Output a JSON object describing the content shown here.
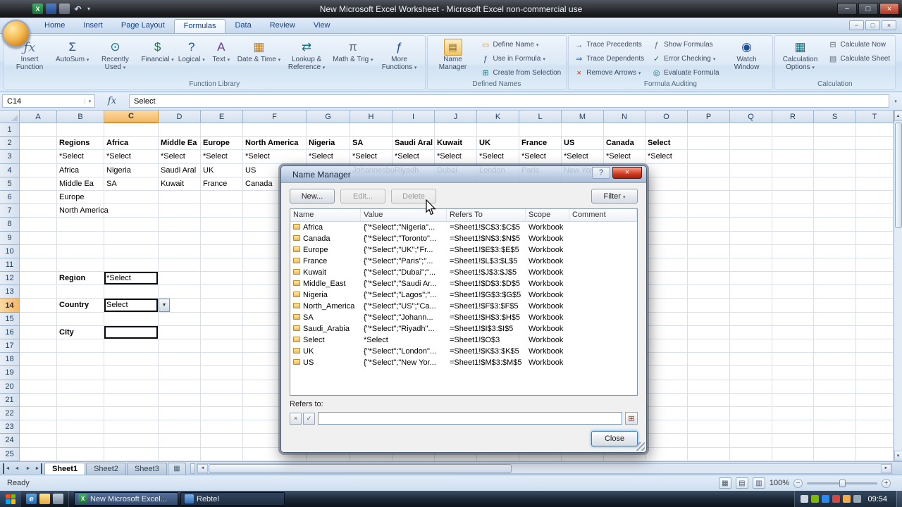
{
  "titlebar": {
    "title": "New Microsoft Excel Worksheet  -  Microsoft Excel non-commercial use"
  },
  "ribbon": {
    "tabs": [
      "Home",
      "Insert",
      "Page Layout",
      "Formulas",
      "Data",
      "Review",
      "View"
    ],
    "active_tab": "Formulas",
    "function_library_label": "Function Library",
    "insert_function": "Insert Function",
    "autosum": "AutoSum",
    "recently_used": "Recently Used",
    "financial": "Financial",
    "logical": "Logical",
    "text": "Text",
    "date_time": "Date & Time",
    "lookup_reference": "Lookup & Reference",
    "math_trig": "Math & Trig",
    "more_functions": "More Functions",
    "defined_names_label": "Defined Names",
    "name_manager": "Name Manager",
    "define_name": "Define Name",
    "use_in_formula": "Use in Formula",
    "create_from_selection": "Create from Selection",
    "formula_auditing_label": "Formula Auditing",
    "trace_precedents": "Trace Precedents",
    "trace_dependents": "Trace Dependents",
    "remove_arrows": "Remove Arrows",
    "show_formulas": "Show Formulas",
    "error_checking": "Error Checking",
    "evaluate_formula": "Evaluate Formula",
    "watch_window": "Watch Window",
    "calculation_label": "Calculation",
    "calculation_options": "Calculation Options",
    "calculate_now": "Calculate Now",
    "calculate_sheet": "Calculate Sheet"
  },
  "formula_bar": {
    "name_box": "C14",
    "formula": "Select"
  },
  "grid": {
    "columns": [
      [
        "A",
        53
      ],
      [
        "B",
        67
      ],
      [
        "C",
        77
      ],
      [
        "D",
        60
      ],
      [
        "E",
        60
      ],
      [
        "F",
        90
      ],
      [
        "G",
        62
      ],
      [
        "H",
        60
      ],
      [
        "I",
        60
      ],
      [
        "J",
        60
      ],
      [
        "K",
        60
      ],
      [
        "L",
        60
      ],
      [
        "M",
        60
      ],
      [
        "N",
        59
      ],
      [
        "O",
        60
      ],
      [
        "P",
        60
      ],
      [
        "Q",
        60
      ],
      [
        "R",
        59
      ],
      [
        "S",
        60
      ],
      [
        "T",
        53
      ]
    ],
    "rows": 25,
    "active_cell": "C14",
    "selected_col": "C",
    "selected_row": 14,
    "cells": {
      "B2": {
        "t": "Regions",
        "b": 1
      },
      "C2": {
        "t": "Africa",
        "b": 1
      },
      "D2": {
        "t": "Middle Ea",
        "b": 1
      },
      "E2": {
        "t": "Europe",
        "b": 1
      },
      "F2": {
        "t": "North America",
        "b": 1
      },
      "G2": {
        "t": "Nigeria",
        "b": 1
      },
      "H2": {
        "t": "SA",
        "b": 1
      },
      "I2": {
        "t": "Saudi Aral",
        "b": 1
      },
      "J2": {
        "t": "Kuwait",
        "b": 1
      },
      "K2": {
        "t": "UK",
        "b": 1
      },
      "L2": {
        "t": "France",
        "b": 1
      },
      "M2": {
        "t": "US",
        "b": 1
      },
      "N2": {
        "t": "Canada",
        "b": 1
      },
      "O2": {
        "t": "Select",
        "b": 1
      },
      "B3": {
        "t": "*Select"
      },
      "C3": {
        "t": "*Select"
      },
      "D3": {
        "t": "*Select"
      },
      "E3": {
        "t": "*Select"
      },
      "F3": {
        "t": "*Select"
      },
      "G3": {
        "t": "*Select"
      },
      "H3": {
        "t": "*Select"
      },
      "I3": {
        "t": "*Select"
      },
      "J3": {
        "t": "*Select"
      },
      "K3": {
        "t": "*Select"
      },
      "L3": {
        "t": "*Select"
      },
      "M3": {
        "t": "*Select"
      },
      "N3": {
        "t": "*Select"
      },
      "O3": {
        "t": "*Select"
      },
      "B4": {
        "t": "Africa"
      },
      "C4": {
        "t": "Nigeria"
      },
      "D4": {
        "t": "Saudi Aral"
      },
      "E4": {
        "t": "UK"
      },
      "F4": {
        "t": "US"
      },
      "H4": {
        "t": "Johannesbu"
      },
      "I4": {
        "t": "Riyadh"
      },
      "J4": {
        "t": "Dubai"
      },
      "K4": {
        "t": "London"
      },
      "L4": {
        "t": "Paris"
      },
      "M4": {
        "t": "New York"
      },
      "B5": {
        "t": "Middle Ea"
      },
      "C5": {
        "t": "SA"
      },
      "D5": {
        "t": "Kuwait"
      },
      "E5": {
        "t": "France"
      },
      "F5": {
        "t": "Canada"
      },
      "B6": {
        "t": "Europe"
      },
      "B7": {
        "t": "North America"
      },
      "B12": {
        "t": "Region",
        "b": 1
      },
      "C12": {
        "t": "*Select",
        "box": 1
      },
      "B14": {
        "t": "Country",
        "b": 1
      },
      "C14": {
        "t": "Select",
        "box": 1,
        "dd": 1
      },
      "B16": {
        "t": "City",
        "b": 1
      },
      "C16": {
        "t": "",
        "box": 1
      }
    }
  },
  "name_manager": {
    "title": "Name Manager",
    "help_button": "?",
    "buttons": {
      "new": "New...",
      "edit": "Edit...",
      "delete": "Delete",
      "filter": "Filter"
    },
    "columns": [
      "Name",
      "Value",
      "Refers To",
      "Scope",
      "Comment"
    ],
    "rows": [
      {
        "name": "Africa",
        "value": "{\"*Select\";\"Nigeria\"...",
        "refers_to": "=Sheet1!$C$3:$C$5",
        "scope": "Workbook",
        "comment": ""
      },
      {
        "name": "Canada",
        "value": "{\"*Select\";\"Toronto\"...",
        "refers_to": "=Sheet1!$N$3:$N$5",
        "scope": "Workbook",
        "comment": ""
      },
      {
        "name": "Europe",
        "value": "{\"*Select\";\"UK\";\"Fr...",
        "refers_to": "=Sheet1!$E$3:$E$5",
        "scope": "Workbook",
        "comment": ""
      },
      {
        "name": "France",
        "value": "{\"*Select\";\"Paris\";\"...",
        "refers_to": "=Sheet1!$L$3:$L$5",
        "scope": "Workbook",
        "comment": ""
      },
      {
        "name": "Kuwait",
        "value": "{\"*Select\";\"Dubai\";\"...",
        "refers_to": "=Sheet1!$J$3:$J$5",
        "scope": "Workbook",
        "comment": ""
      },
      {
        "name": "Middle_East",
        "value": "{\"*Select\";\"Saudi Ar...",
        "refers_to": "=Sheet1!$D$3:$D$5",
        "scope": "Workbook",
        "comment": ""
      },
      {
        "name": "Nigeria",
        "value": "{\"*Select\";\"Lagos\";\"...",
        "refers_to": "=Sheet1!$G$3:$G$5",
        "scope": "Workbook",
        "comment": ""
      },
      {
        "name": "North_America",
        "value": "{\"*Select\";\"US\";\"Ca...",
        "refers_to": "=Sheet1!$F$3:$F$5",
        "scope": "Workbook",
        "comment": ""
      },
      {
        "name": "SA",
        "value": "{\"*Select\";\"Johann...",
        "refers_to": "=Sheet1!$H$3:$H$5",
        "scope": "Workbook",
        "comment": ""
      },
      {
        "name": "Saudi_Arabia",
        "value": "{\"*Select\";\"Riyadh\"...",
        "refers_to": "=Sheet1!$I$3:$I$5",
        "scope": "Workbook",
        "comment": ""
      },
      {
        "name": "Select",
        "value": "*Select",
        "refers_to": "=Sheet1!$O$3",
        "scope": "Workbook",
        "comment": ""
      },
      {
        "name": "UK",
        "value": "{\"*Select\";\"London\"...",
        "refers_to": "=Sheet1!$K$3:$K$5",
        "scope": "Workbook",
        "comment": ""
      },
      {
        "name": "US",
        "value": "{\"*Select\";\"New Yor...",
        "refers_to": "=Sheet1!$M$3:$M$5",
        "scope": "Workbook",
        "comment": ""
      }
    ],
    "refers_to_label": "Refers to:",
    "refers_to_value": "",
    "close_button": "Close"
  },
  "sheet_tabs": {
    "tabs": [
      "Sheet1",
      "Sheet2",
      "Sheet3"
    ],
    "active": "Sheet1"
  },
  "status_bar": {
    "ready": "Ready",
    "zoom": "100%"
  },
  "taskbar": {
    "tasks": [
      {
        "label": "New Microsoft Excel...",
        "icon": "excel-task-icon",
        "active": true
      },
      {
        "label": "Rebtel",
        "icon": "rebtel-task-icon",
        "active": false
      }
    ],
    "time": "09:54"
  }
}
